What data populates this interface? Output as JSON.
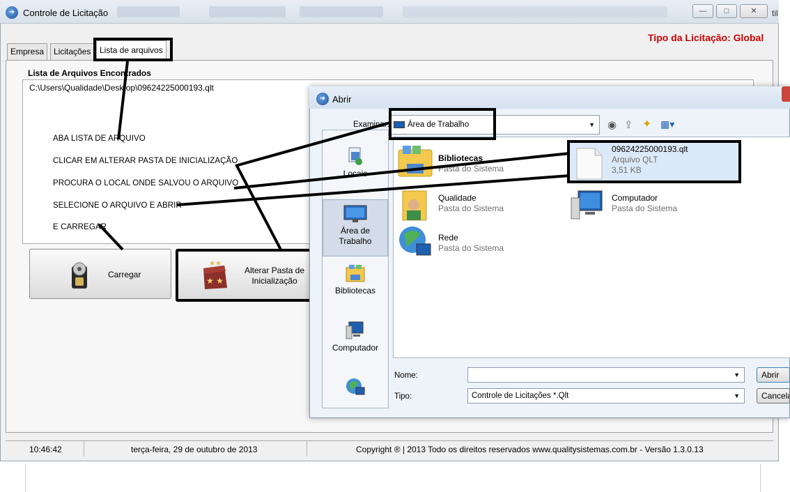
{
  "window": {
    "title": "Controle de Licitação",
    "title_right": "til",
    "tipo_licitacao": "Tipo da Licitação: Global"
  },
  "tabs": [
    {
      "label": "Empresa"
    },
    {
      "label": "Licitações"
    },
    {
      "label": "Lista de arquivos"
    }
  ],
  "list": {
    "heading": "Lista de Arquivos Encontrados",
    "items": [
      "C:\\Users\\Qualidade\\Desktop\\09624225000193.qlt"
    ]
  },
  "instructions": [
    "ABA LISTA DE ARQUIVO",
    "CLICAR EM ALTERAR PASTA DE INICIALIZAÇÃO",
    "PROCURA O LOCAL ONDE SALVOU O ARQUIVO",
    "SELECIONE O ARQUIVO E ABRIR",
    "E CARREGAR"
  ],
  "buttons": {
    "carregar": "Carregar",
    "alterar_line1": "Alterar Pasta de",
    "alterar_line2": "Inicialização"
  },
  "status": {
    "time": "10:46:42",
    "date": "terça-feira, 29 de outubro de 2013",
    "copyright": "Copyright ® | 2013 Todo os direitos reservados www.qualitysistemas.com.br - Versão  1.3.0.13"
  },
  "dialog": {
    "title": "Abrir",
    "look_in_label": "Examinar:",
    "look_in_value": "Área de Trabalho",
    "places": [
      {
        "label": "Locais",
        "icon": "recent-places-icon"
      },
      {
        "label": "Área de Trabalho",
        "icon": "desktop-icon"
      },
      {
        "label": "Bibliotecas",
        "icon": "libraries-icon"
      },
      {
        "label": "Computador",
        "icon": "computer-icon"
      },
      {
        "label": "",
        "icon": "network-icon"
      }
    ],
    "items": [
      {
        "name": "Bibliotecas",
        "sub": "Pasta do Sistema",
        "icon": "libraries-folder-icon"
      },
      {
        "name": "09624225000193.qlt",
        "sub": "Arquivo QLT",
        "size": "3,51 KB",
        "icon": "file-icon"
      },
      {
        "name": "Qualidade",
        "sub": "Pasta do Sistema",
        "icon": "user-folder-icon"
      },
      {
        "name": "Computador",
        "sub": "Pasta do Sistema",
        "icon": "computer-icon"
      },
      {
        "name": "Rede",
        "sub": "Pasta do Sistema",
        "icon": "network-icon"
      }
    ],
    "name_label": "Nome:",
    "name_value": "",
    "type_label": "Tipo:",
    "type_value": "Controle de Licitações  *.Qlt",
    "open_button": "Abrir",
    "cancel_button": "Cancelar"
  },
  "colors": {
    "accent_red": "#cc0000",
    "selection": "#dce9f8"
  }
}
